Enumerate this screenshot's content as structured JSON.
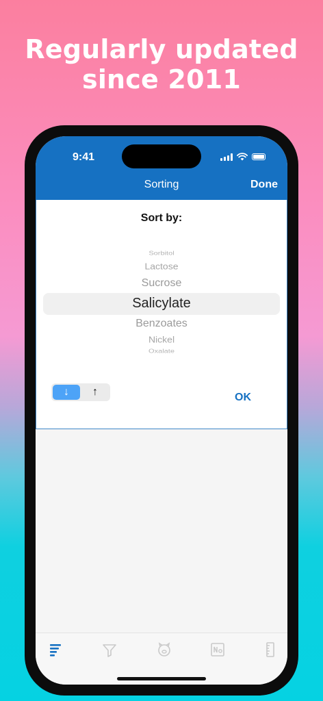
{
  "headline": {
    "line1": "Regularly updated",
    "line2": "since 2011"
  },
  "status_bar": {
    "time": "9:41"
  },
  "navbar": {
    "title": "Sorting",
    "done_label": "Done"
  },
  "sheet": {
    "sort_label": "Sort by:",
    "picker_items": [
      "Sorbitol",
      "Lactose",
      "Sucrose",
      "Salicylate",
      "Benzoates",
      "Nickel",
      "Oxalate"
    ],
    "selected_item": "Salicylate",
    "sort_down_label": "↓",
    "sort_up_label": "↑",
    "ok_label": "OK"
  },
  "colors": {
    "accent": "#1671c2",
    "segment_selected": "#4da3f7",
    "tab_active": "#1671c2",
    "tab_inactive": "#c9c9c9"
  },
  "tabs": [
    {
      "icon": "sort-bars-icon",
      "active": true
    },
    {
      "icon": "funnel-icon",
      "active": false
    },
    {
      "icon": "piggy-icon",
      "active": false
    },
    {
      "icon": "element-na-icon",
      "active": false
    },
    {
      "icon": "ruler-icon",
      "active": false
    }
  ]
}
